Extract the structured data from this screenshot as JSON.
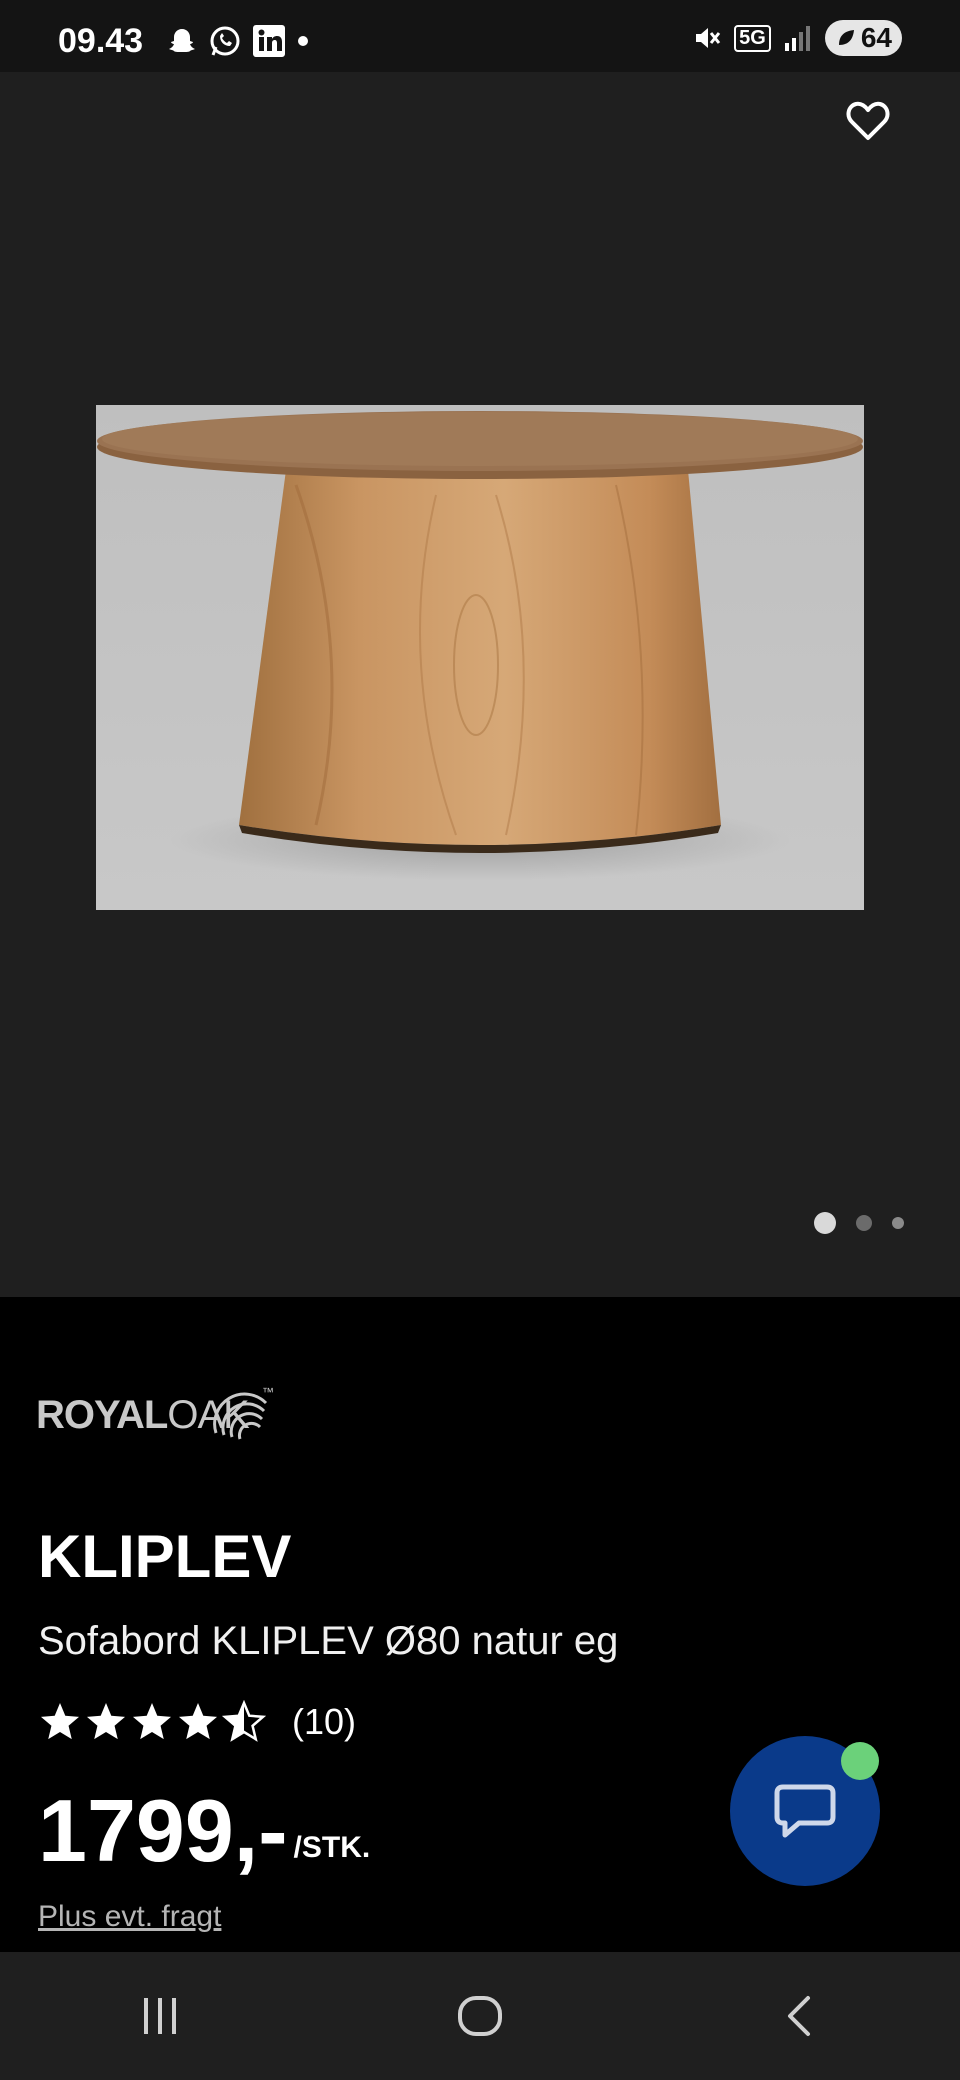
{
  "status_bar": {
    "time": "09.43",
    "battery": "64",
    "network": "5G"
  },
  "product": {
    "brand": {
      "part1": "ROYAL",
      "part2": "OAK",
      "tm": "™"
    },
    "name": "KLIPLEV",
    "description": "Sofabord KLIPLEV Ø80 natur eg",
    "rating": 4.5,
    "rating_count": "(10)",
    "price": "1799,-",
    "price_unit": "/STK.",
    "shipping_note": "Plus evt. fragt"
  },
  "gallery": {
    "total_images": 3,
    "active_index": 0
  },
  "icons": {
    "favorite": "heart-outline-icon",
    "chat": "chat-bubble-icon"
  },
  "colors": {
    "chat_button": "#0a3a8a",
    "online_indicator": "#6bd17a"
  }
}
